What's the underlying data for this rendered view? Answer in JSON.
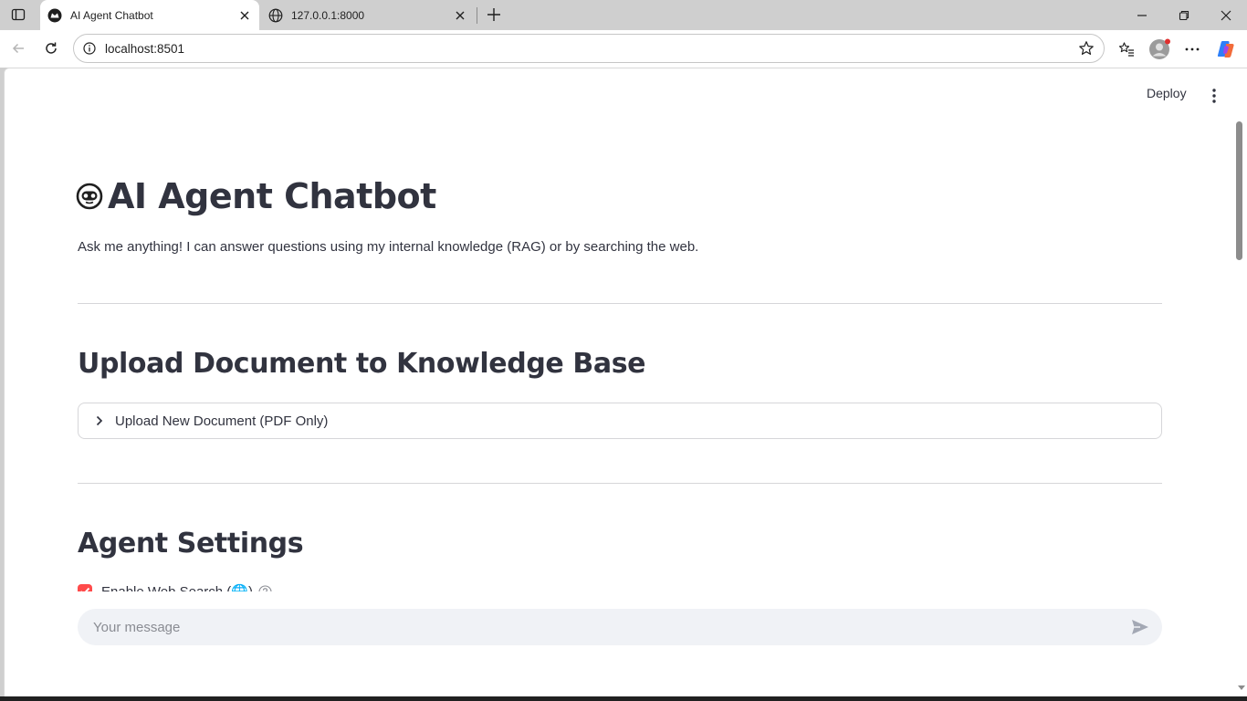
{
  "browser": {
    "tabs": [
      {
        "title": "AI Agent Chatbot",
        "active": true
      },
      {
        "title": "127.0.0.1:8000",
        "active": false
      }
    ],
    "url": "localhost:8501"
  },
  "app": {
    "header": {
      "deploy_label": "Deploy"
    },
    "title": "AI Agent Chatbot",
    "subtitle": "Ask me anything! I can answer questions using my internal knowledge (RAG) or by searching the web.",
    "upload_section": {
      "heading": "Upload Document to Knowledge Base",
      "expander_label": "Upload New Document (PDF Only)"
    },
    "settings_section": {
      "heading": "Agent Settings",
      "web_search": {
        "label": "Enable Web Search (🌐)",
        "checked": true
      }
    },
    "chat": {
      "placeholder": "Your message",
      "value": ""
    }
  },
  "colors": {
    "accent": "#ff4b4b",
    "text": "#31333f",
    "input_bg": "#f0f2f6"
  }
}
